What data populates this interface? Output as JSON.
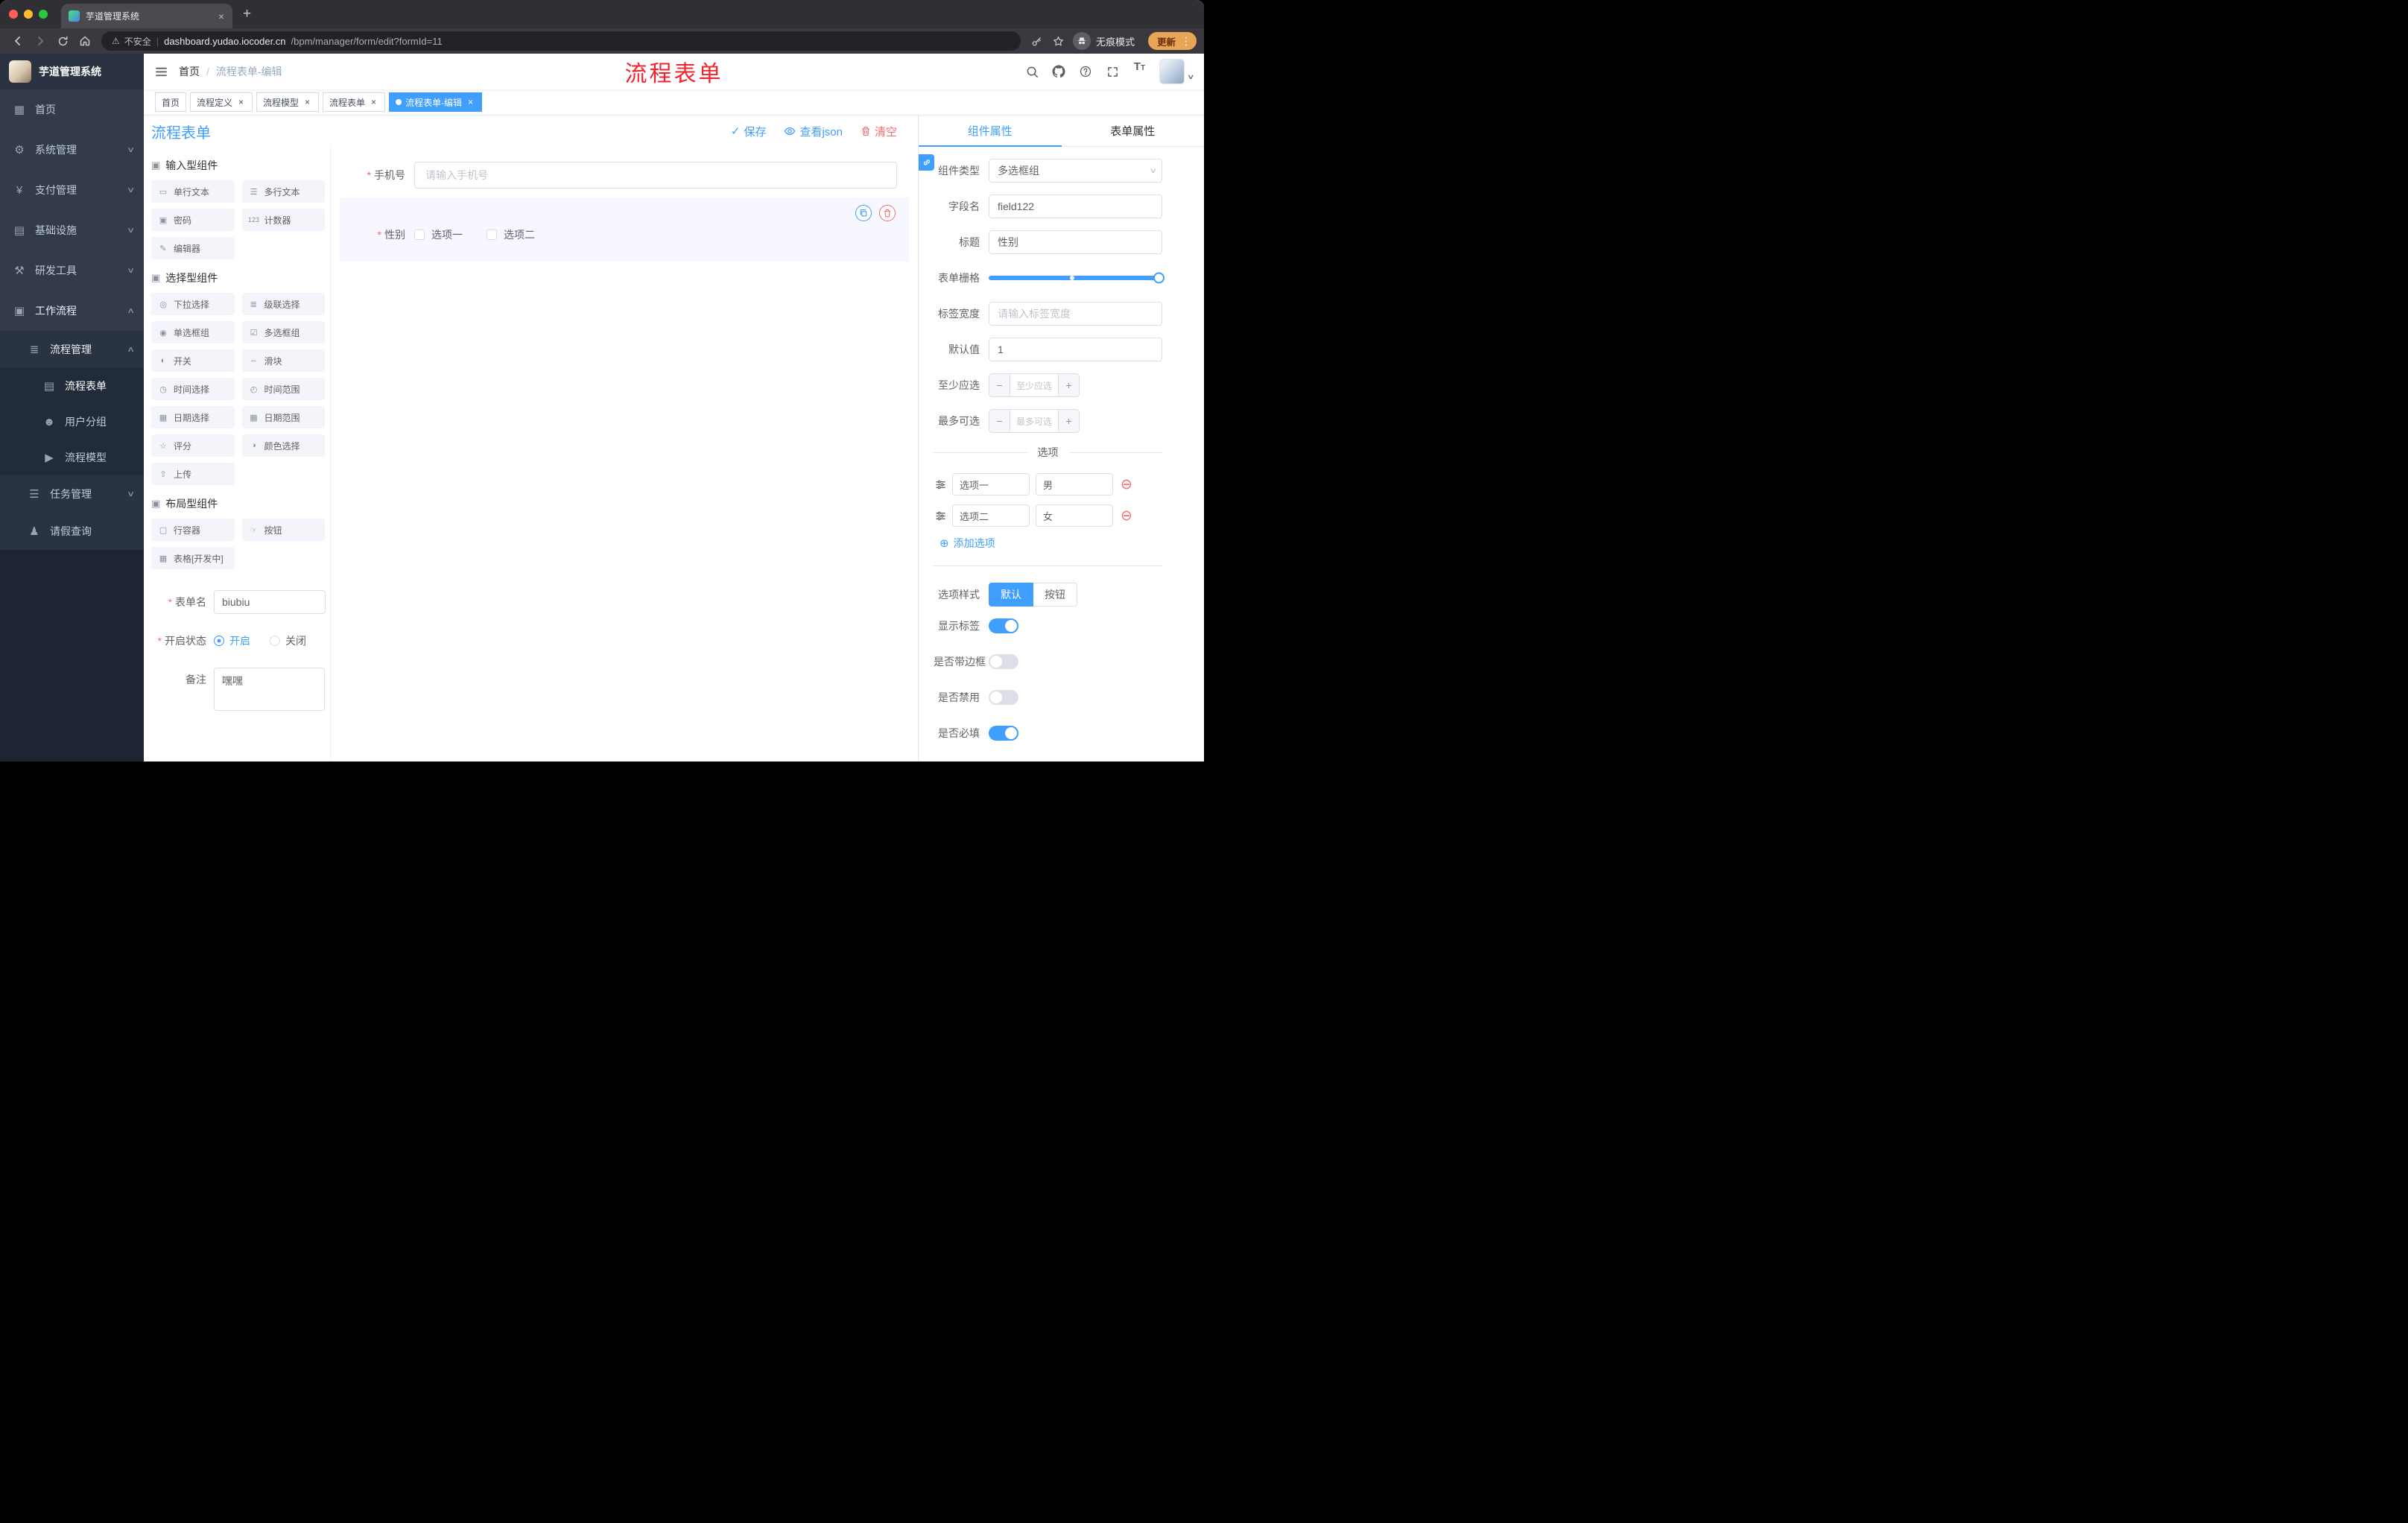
{
  "browser": {
    "tab_title": "芋道管理系统",
    "security_label": "不安全",
    "url_domain": "dashboard.yudao.iocoder.cn",
    "url_path": "/bpm/manager/form/edit?formId=11",
    "incognito_label": "无痕模式",
    "update_label": "更新"
  },
  "sidebar": {
    "app_title": "芋道管理系统",
    "menu": [
      {
        "icon": "▦",
        "label": "首页"
      },
      {
        "icon": "⚙",
        "label": "系统管理",
        "arrow": "∨"
      },
      {
        "icon": "¥",
        "label": "支付管理",
        "arrow": "∨"
      },
      {
        "icon": "▤",
        "label": "基础设施",
        "arrow": "∨"
      },
      {
        "icon": "⚒",
        "label": "研发工具",
        "arrow": "∨"
      },
      {
        "icon": "▣",
        "label": "工作流程",
        "arrow": "∧"
      }
    ],
    "process_group": {
      "icon": "≣",
      "label": "流程管理",
      "arrow": "∧"
    },
    "process_children": [
      {
        "icon": "▤",
        "label": "流程表单"
      },
      {
        "icon": "☻",
        "label": "用户分组"
      },
      {
        "icon": "▶",
        "label": "流程模型"
      }
    ],
    "task_group": {
      "icon": "☰",
      "label": "任务管理",
      "arrow": "∨"
    },
    "leave_item": {
      "icon": "♟",
      "label": "请假查询"
    }
  },
  "header": {
    "breadcrumb_home": "首页",
    "breadcrumb_current": "流程表单-编辑",
    "annotation": "流程表单"
  },
  "tags": [
    {
      "label": "首页"
    },
    {
      "label": "流程定义"
    },
    {
      "label": "流程模型"
    },
    {
      "label": "流程表单"
    },
    {
      "label": "流程表单-编辑"
    }
  ],
  "designer": {
    "title": "流程表单",
    "save_label": "保存",
    "json_label": "查看json",
    "clear_label": "清空",
    "groups": [
      {
        "title": "输入型组件",
        "items": [
          {
            "icon": "▭",
            "label": "单行文本"
          },
          {
            "icon": "☰",
            "label": "多行文本"
          },
          {
            "icon": "▣",
            "label": "密码"
          },
          {
            "icon": "123",
            "label": "计数器"
          },
          {
            "icon": "✎",
            "label": "编辑器"
          }
        ]
      },
      {
        "title": "选择型组件",
        "items": [
          {
            "icon": "◎",
            "label": "下拉选择"
          },
          {
            "icon": "≣",
            "label": "级联选择"
          },
          {
            "icon": "◉",
            "label": "单选框组"
          },
          {
            "icon": "☑",
            "label": "多选框组"
          },
          {
            "icon": "◐",
            "label": "开关"
          },
          {
            "icon": "⇔",
            "label": "滑块"
          },
          {
            "icon": "◷",
            "label": "时间选择"
          },
          {
            "icon": "◴",
            "label": "时间范围"
          },
          {
            "icon": "▦",
            "label": "日期选择"
          },
          {
            "icon": "▦",
            "label": "日期范围"
          },
          {
            "icon": "☆",
            "label": "评分"
          },
          {
            "icon": "◑",
            "label": "颜色选择"
          },
          {
            "icon": "⇧",
            "label": "上传"
          }
        ]
      },
      {
        "title": "布局型组件",
        "items": [
          {
            "icon": "▢",
            "label": "行容器"
          },
          {
            "icon": "☞",
            "label": "按钮"
          },
          {
            "icon": "▦",
            "label": "表格[开发中]"
          }
        ]
      }
    ],
    "meta": {
      "name_label": "表单名",
      "name_value": "biubiu",
      "status_label": "开启状态",
      "status_on": "开启",
      "status_off": "关闭",
      "remark_label": "备注",
      "remark_value": "嘿嘿"
    },
    "canvas": {
      "phone_label": "手机号",
      "phone_placeholder": "请输入手机号",
      "gender_label": "性别",
      "gender_option1": "选项一",
      "gender_option2": "选项二"
    }
  },
  "props": {
    "tab_component": "组件属性",
    "tab_form": "表单属性",
    "type_label": "组件类型",
    "type_value": "多选框组",
    "field_label": "字段名",
    "field_value": "field122",
    "title_label": "标题",
    "title_value": "性别",
    "grid_label": "表单栅格",
    "width_label": "标签宽度",
    "width_placeholder": "请输入标签宽度",
    "default_label": "默认值",
    "default_value": "1",
    "min_label": "至少应选",
    "min_placeholder": "至少应选",
    "max_label": "最多可选",
    "max_placeholder": "最多可选",
    "options_title": "选项",
    "options": [
      {
        "label": "选项一",
        "value": "男"
      },
      {
        "label": "选项二",
        "value": "女"
      }
    ],
    "add_option": "添加选项",
    "style_label": "选项样式",
    "style_default": "默认",
    "style_button": "按钮",
    "toggles": [
      {
        "label": "显示标签",
        "on": true
      },
      {
        "label": "是否带边框",
        "on": false
      },
      {
        "label": "是否禁用",
        "on": false
      },
      {
        "label": "是否必填",
        "on": true
      }
    ]
  }
}
